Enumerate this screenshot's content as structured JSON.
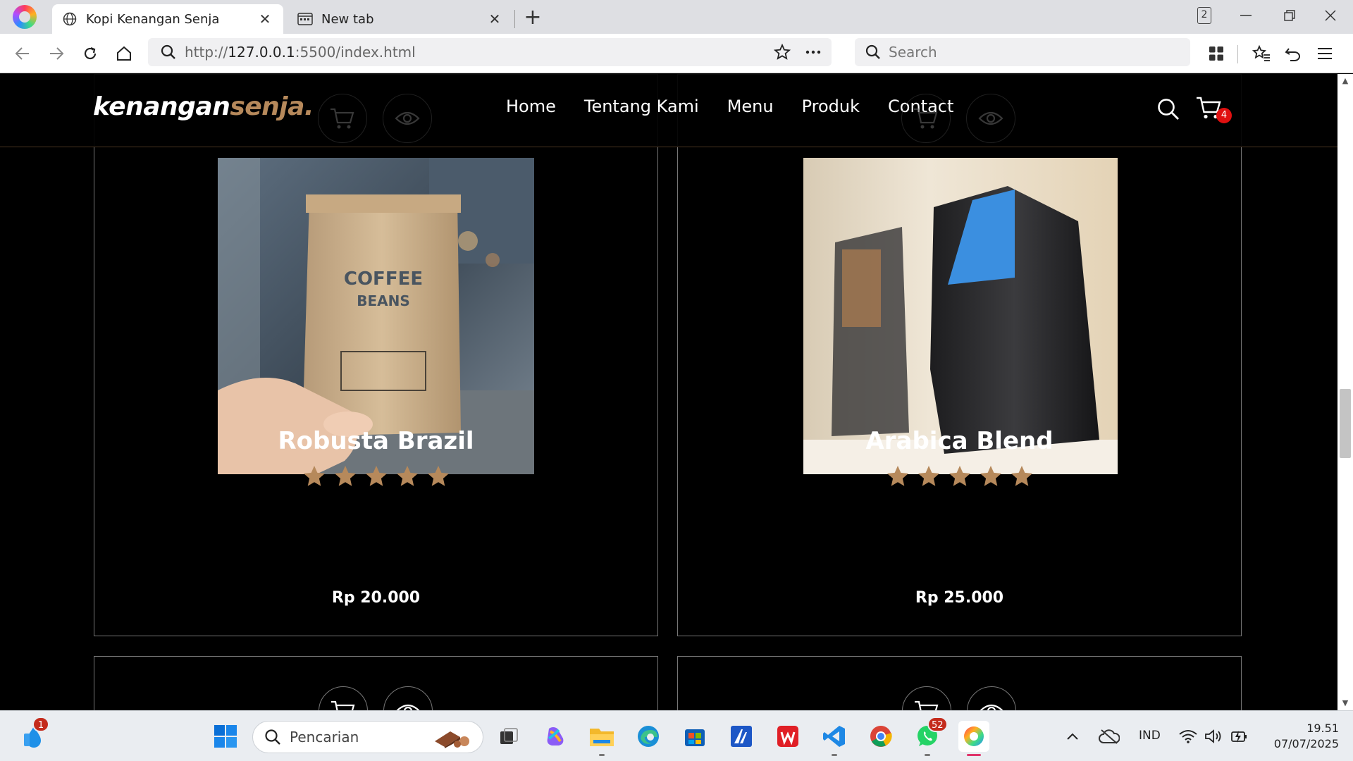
{
  "browser": {
    "active_tab": {
      "title": "Kopi Kenangan Senja"
    },
    "inactive_tab": {
      "title": "New tab"
    },
    "tab_count": "2",
    "url": {
      "scheme": "http://",
      "host": "127.0.0.1",
      "rest": ":5500/index.html"
    },
    "search_placeholder": "Search"
  },
  "site": {
    "logo": {
      "main": "kenangan",
      "accent": "senja."
    },
    "nav": [
      "Home",
      "Tentang Kami",
      "Menu",
      "Produk",
      "Contact"
    ],
    "cart_count": "4",
    "accent_color": "#b6895b"
  },
  "products": [
    {
      "name": "Robusta Brazil",
      "rating": 5,
      "price": "Rp 20.000"
    },
    {
      "name": "Arabica Blend",
      "rating": 5,
      "price": "Rp 25.000"
    }
  ],
  "taskbar": {
    "search_placeholder": "Pencarian",
    "notification_badge": "1",
    "whatsapp_badge": "52",
    "language": "IND",
    "time": "19.51",
    "date": "07/07/2025"
  }
}
